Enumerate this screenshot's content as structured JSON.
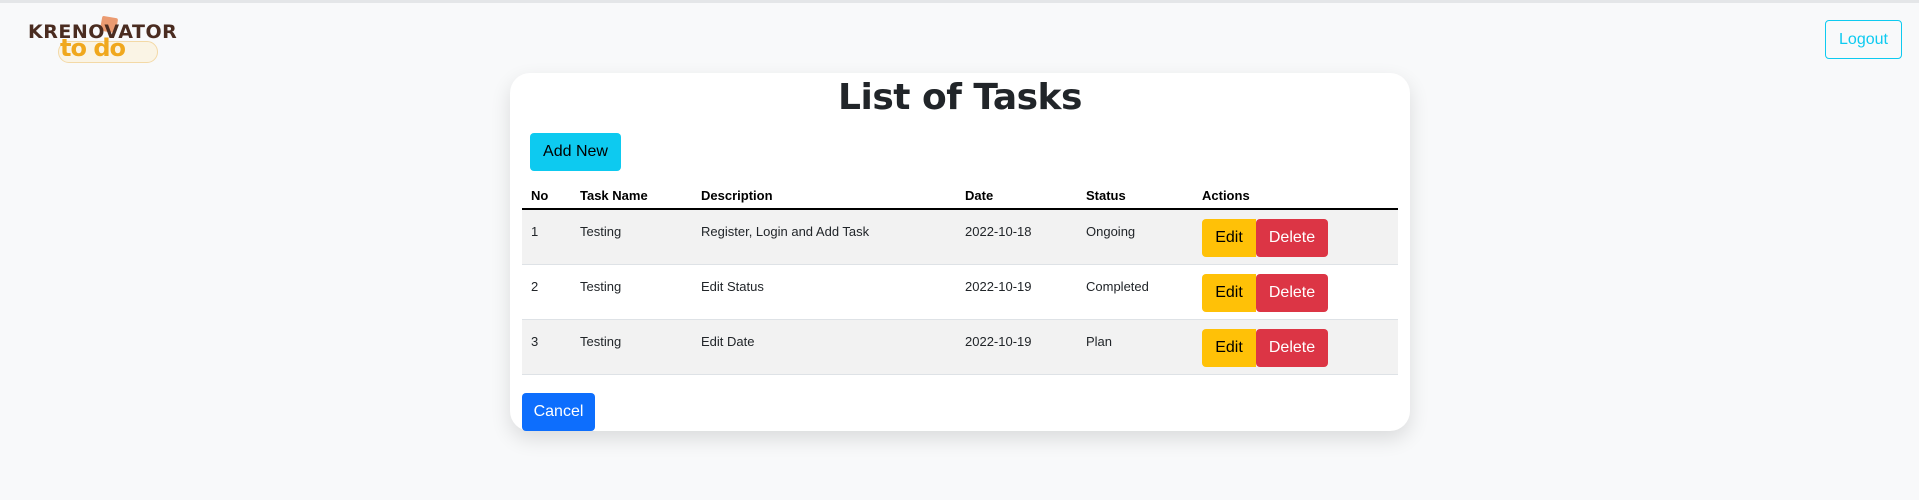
{
  "brand": {
    "name": "KRENOVATOR",
    "sub": "to do"
  },
  "navbar": {
    "logout_label": "Logout"
  },
  "page": {
    "title": "List of Tasks"
  },
  "toolbar": {
    "add_label": "Add New"
  },
  "table": {
    "headers": [
      "No",
      "Task Name",
      "Description",
      "Date",
      "Status",
      "Actions"
    ],
    "rows": [
      {
        "no": "1",
        "name": "Testing",
        "description": "Register, Login and Add Task",
        "date": "2022-10-18",
        "status": "Ongoing"
      },
      {
        "no": "2",
        "name": "Testing",
        "description": "Edit Status",
        "date": "2022-10-19",
        "status": "Completed"
      },
      {
        "no": "3",
        "name": "Testing",
        "description": "Edit Date",
        "date": "2022-10-19",
        "status": "Plan"
      }
    ],
    "edit_label": "Edit",
    "delete_label": "Delete"
  },
  "footer": {
    "cancel_label": "Cancel"
  },
  "colors": {
    "info": "#0dcaf0",
    "warning": "#ffc107",
    "danger": "#dc3545",
    "primary": "#0d6efd",
    "background": "#f8f9fa"
  }
}
